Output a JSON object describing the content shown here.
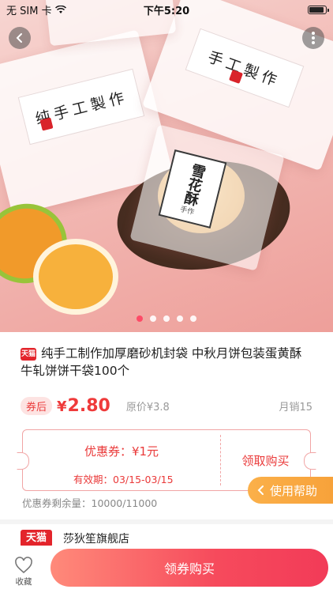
{
  "status_bar": {
    "carrier": "无 SIM 卡",
    "time": "下午5:20"
  },
  "hero": {
    "bag_labels": {
      "left_main": "纯手工製作",
      "right_main": "手工製作",
      "center_main": "雪花酥",
      "center_sub": "手作"
    },
    "carousel_count": 5,
    "carousel_active_index": 0
  },
  "product": {
    "shop_badge": "天猫",
    "title": "纯手工制作加厚磨砂机封袋 中秋月饼包装蛋黄酥牛轧饼饼干袋100个"
  },
  "price": {
    "tag": "券后",
    "currency": "¥",
    "value": "2.80",
    "original": "原价¥3.8",
    "sales": "月销15"
  },
  "coupon": {
    "amount": "优惠券：¥1元",
    "validity": "有效期：03/15-03/15",
    "action": "领取购买",
    "remaining": "优惠券剩余量：10000/11000"
  },
  "help": {
    "label": "使用帮助"
  },
  "store": {
    "logo": "天猫",
    "name": "莎狄笙旗舰店"
  },
  "bottom": {
    "favorite_label": "收藏",
    "buy_label": "领券购买"
  },
  "colors": {
    "accent": "#ef3a3a",
    "buy_gradient_start": "#ff8a7a",
    "buy_gradient_end": "#f23b58",
    "help_orange": "#f7a23a"
  }
}
